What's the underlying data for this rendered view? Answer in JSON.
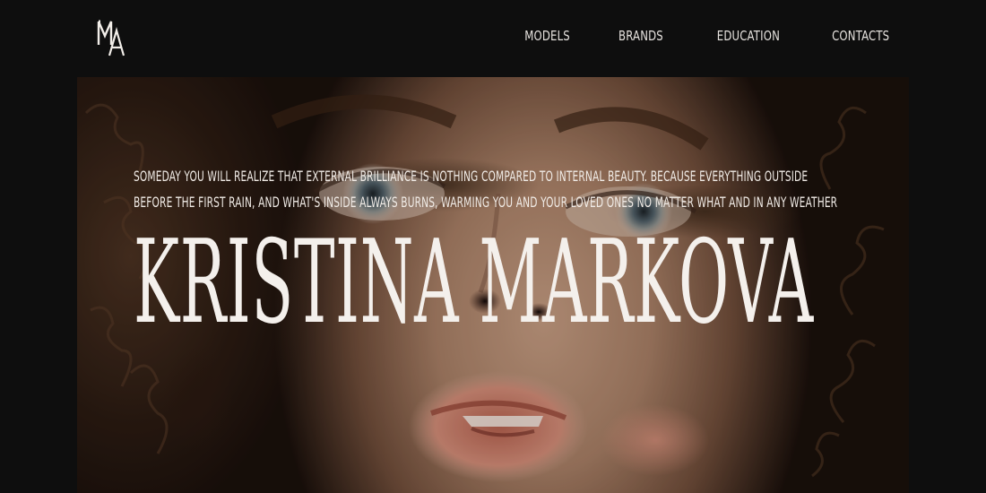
{
  "header": {
    "logo_text": "MA",
    "nav": [
      {
        "label": "MODELS"
      },
      {
        "label": "BRANDS"
      },
      {
        "label": "EDUCATION"
      },
      {
        "label": "CONTACTS"
      }
    ]
  },
  "hero": {
    "tagline_line_1": "SOMEDAY YOU WILL REALIZE THAT EXTERNAL BRILLIANCE IS NOTHING COMPARED TO INTERNAL BEAUTY. BECAUSE EVERYTHING OUTSIDE",
    "tagline_line_2": "BEFORE THE FIRST RAIN, AND WHAT'S INSIDE ALWAYS BURNS, WARMING YOU AND YOUR LOVED ONES NO MATTER WHAT AND IN ANY WEATHER",
    "title": "KRISTINA MARKOVA"
  },
  "colors": {
    "background": "#0e0e0e",
    "text": "#efeae6"
  }
}
